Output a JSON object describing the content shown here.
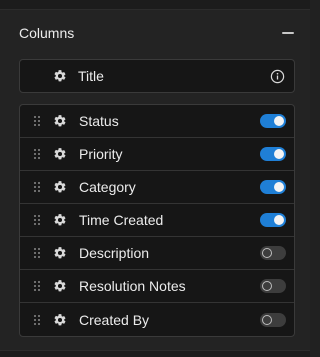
{
  "section": {
    "title": "Columns"
  },
  "pinned": {
    "label": "Title",
    "icon": "gear-icon",
    "info_icon": "info-icon"
  },
  "columns": [
    {
      "label": "Status",
      "enabled": true
    },
    {
      "label": "Priority",
      "enabled": true
    },
    {
      "label": "Category",
      "enabled": true
    },
    {
      "label": "Time Created",
      "enabled": true
    },
    {
      "label": "Description",
      "enabled": false
    },
    {
      "label": "Resolution Notes",
      "enabled": false
    },
    {
      "label": "Created By",
      "enabled": false
    }
  ],
  "colors": {
    "toggle_on": "#1f7fd6",
    "toggle_off": "#3d3d3d",
    "background": "#232323",
    "row_background": "#161616"
  }
}
